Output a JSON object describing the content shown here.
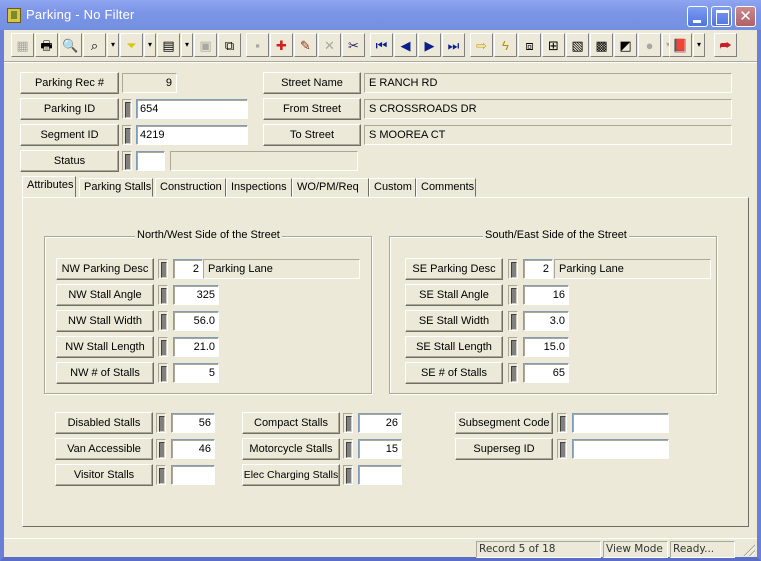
{
  "window": {
    "title": "Parking - No Filter",
    "controls": {
      "minimize": "minimize",
      "maximize": "maximize",
      "close": "close"
    }
  },
  "toolbar": {
    "buttons": [
      {
        "name": "grid-view-icon",
        "glyph": "▦",
        "enabled": false
      },
      {
        "name": "print-icon",
        "glyph": "🖶",
        "enabled": true
      },
      {
        "name": "print-preview-icon",
        "glyph": "🔍",
        "enabled": true
      },
      {
        "name": "find-icon",
        "glyph": "⌕",
        "enabled": true
      },
      {
        "name": "find-dropdown-icon",
        "glyph": "▾",
        "enabled": true,
        "dropdown": true
      },
      {
        "name": "filter-icon",
        "glyph": "⏷",
        "enabled": true
      },
      {
        "name": "filter-dropdown-icon",
        "glyph": "▾",
        "enabled": true,
        "dropdown": true
      },
      {
        "name": "report-icon",
        "glyph": "▤",
        "enabled": true
      },
      {
        "name": "report-dropdown-icon",
        "glyph": "▾",
        "enabled": true,
        "dropdown": true
      },
      {
        "name": "properties-icon",
        "glyph": "▣",
        "enabled": false
      },
      {
        "name": "export-icon",
        "glyph": "⧉",
        "enabled": true
      },
      {
        "name": "save-icon",
        "glyph": "▪",
        "enabled": false
      },
      {
        "name": "new-record-icon",
        "glyph": "✚",
        "enabled": true
      },
      {
        "name": "edit-pencil-icon",
        "glyph": "✎",
        "enabled": true
      },
      {
        "name": "delete-icon",
        "glyph": "✕",
        "enabled": false
      },
      {
        "name": "cut-icon",
        "glyph": "✂",
        "enabled": true
      },
      {
        "name": "first-record-icon",
        "glyph": "⏮",
        "enabled": true
      },
      {
        "name": "previous-record-icon",
        "glyph": "◀",
        "enabled": true
      },
      {
        "name": "next-record-icon",
        "glyph": "▶",
        "enabled": true
      },
      {
        "name": "last-record-icon",
        "glyph": "⏭",
        "enabled": true
      },
      {
        "name": "goto-arrow-icon",
        "glyph": "⇨",
        "enabled": true
      },
      {
        "name": "lightning-icon",
        "glyph": "ϟ",
        "enabled": true
      },
      {
        "name": "relate-icon",
        "glyph": "⧈",
        "enabled": true
      },
      {
        "name": "diagram-icon",
        "glyph": "⊞",
        "enabled": true
      },
      {
        "name": "map-icon",
        "glyph": "▧",
        "enabled": true
      },
      {
        "name": "calculator-icon",
        "glyph": "▩",
        "enabled": true
      },
      {
        "name": "gis-icon",
        "glyph": "◩",
        "enabled": true
      },
      {
        "name": "comment-icon",
        "glyph": "●",
        "enabled": false
      },
      {
        "name": "comment-dropdown-icon",
        "glyph": "▾",
        "enabled": false,
        "dropdown": true
      },
      {
        "name": "help-book-icon",
        "glyph": "📕",
        "enabled": true
      },
      {
        "name": "help-dropdown-icon",
        "glyph": "▾",
        "enabled": true,
        "dropdown": true
      },
      {
        "name": "exit-icon",
        "glyph": "⮫",
        "enabled": true
      }
    ]
  },
  "header": {
    "parking_rec": {
      "label": "Parking Rec #",
      "value": "9"
    },
    "parking_id": {
      "label": "Parking ID",
      "value": "654"
    },
    "segment_id": {
      "label": "Segment ID",
      "value": "4219"
    },
    "status": {
      "label": "Status",
      "code": "",
      "desc": ""
    },
    "street_name": {
      "label": "Street Name",
      "value": "E  RANCH RD"
    },
    "from_street": {
      "label": "From Street",
      "value": "S  CROSSROADS DR"
    },
    "to_street": {
      "label": "To Street",
      "value": "S  MOOREA CT"
    }
  },
  "tabs": [
    {
      "label": "Attributes",
      "active": true
    },
    {
      "label": "Parking Stalls",
      "active": false
    },
    {
      "label": "Construction",
      "active": false
    },
    {
      "label": "Inspections",
      "active": false
    },
    {
      "label": "WO/PM/Req",
      "active": false
    },
    {
      "label": "Custom",
      "active": false
    },
    {
      "label": "Comments",
      "active": false
    }
  ],
  "nw": {
    "title": "North/West Side of the Street",
    "parking_desc": {
      "label": "NW Parking Desc",
      "code": "2",
      "desc": "Parking Lane"
    },
    "stall_angle": {
      "label": "NW Stall Angle",
      "value": "325"
    },
    "stall_width": {
      "label": "NW Stall Width",
      "value": "56.0"
    },
    "stall_length": {
      "label": "NW Stall Length",
      "value": "21.0"
    },
    "num_stalls": {
      "label": "NW # of Stalls",
      "value": "5"
    }
  },
  "se": {
    "title": "South/East Side of the Street",
    "parking_desc": {
      "label": "SE Parking Desc",
      "code": "2",
      "desc": "Parking Lane"
    },
    "stall_angle": {
      "label": "SE Stall Angle",
      "value": "16"
    },
    "stall_width": {
      "label": "SE Stall Width",
      "value": "3.0"
    },
    "stall_length": {
      "label": "SE Stall Length",
      "value": "15.0"
    },
    "num_stalls": {
      "label": "SE # of Stalls",
      "value": "65"
    }
  },
  "stalls": {
    "disabled": {
      "label": "Disabled Stalls",
      "value": "56"
    },
    "van_accessible": {
      "label": "Van Accessible",
      "value": "46"
    },
    "visitor": {
      "label": "Visitor Stalls",
      "value": ""
    },
    "compact": {
      "label": "Compact Stalls",
      "value": "26"
    },
    "motorcycle": {
      "label": "Motorcycle Stalls",
      "value": "15"
    },
    "elec_charging": {
      "label": "Elec Charging Stalls",
      "value": ""
    },
    "subsegment_code": {
      "label": "Subsegment Code",
      "value": ""
    },
    "superseg_id": {
      "label": "Superseg ID",
      "value": ""
    }
  },
  "statusbar": {
    "record": "Record 5 of 18",
    "mode": "View Mode",
    "state": "Ready..."
  }
}
